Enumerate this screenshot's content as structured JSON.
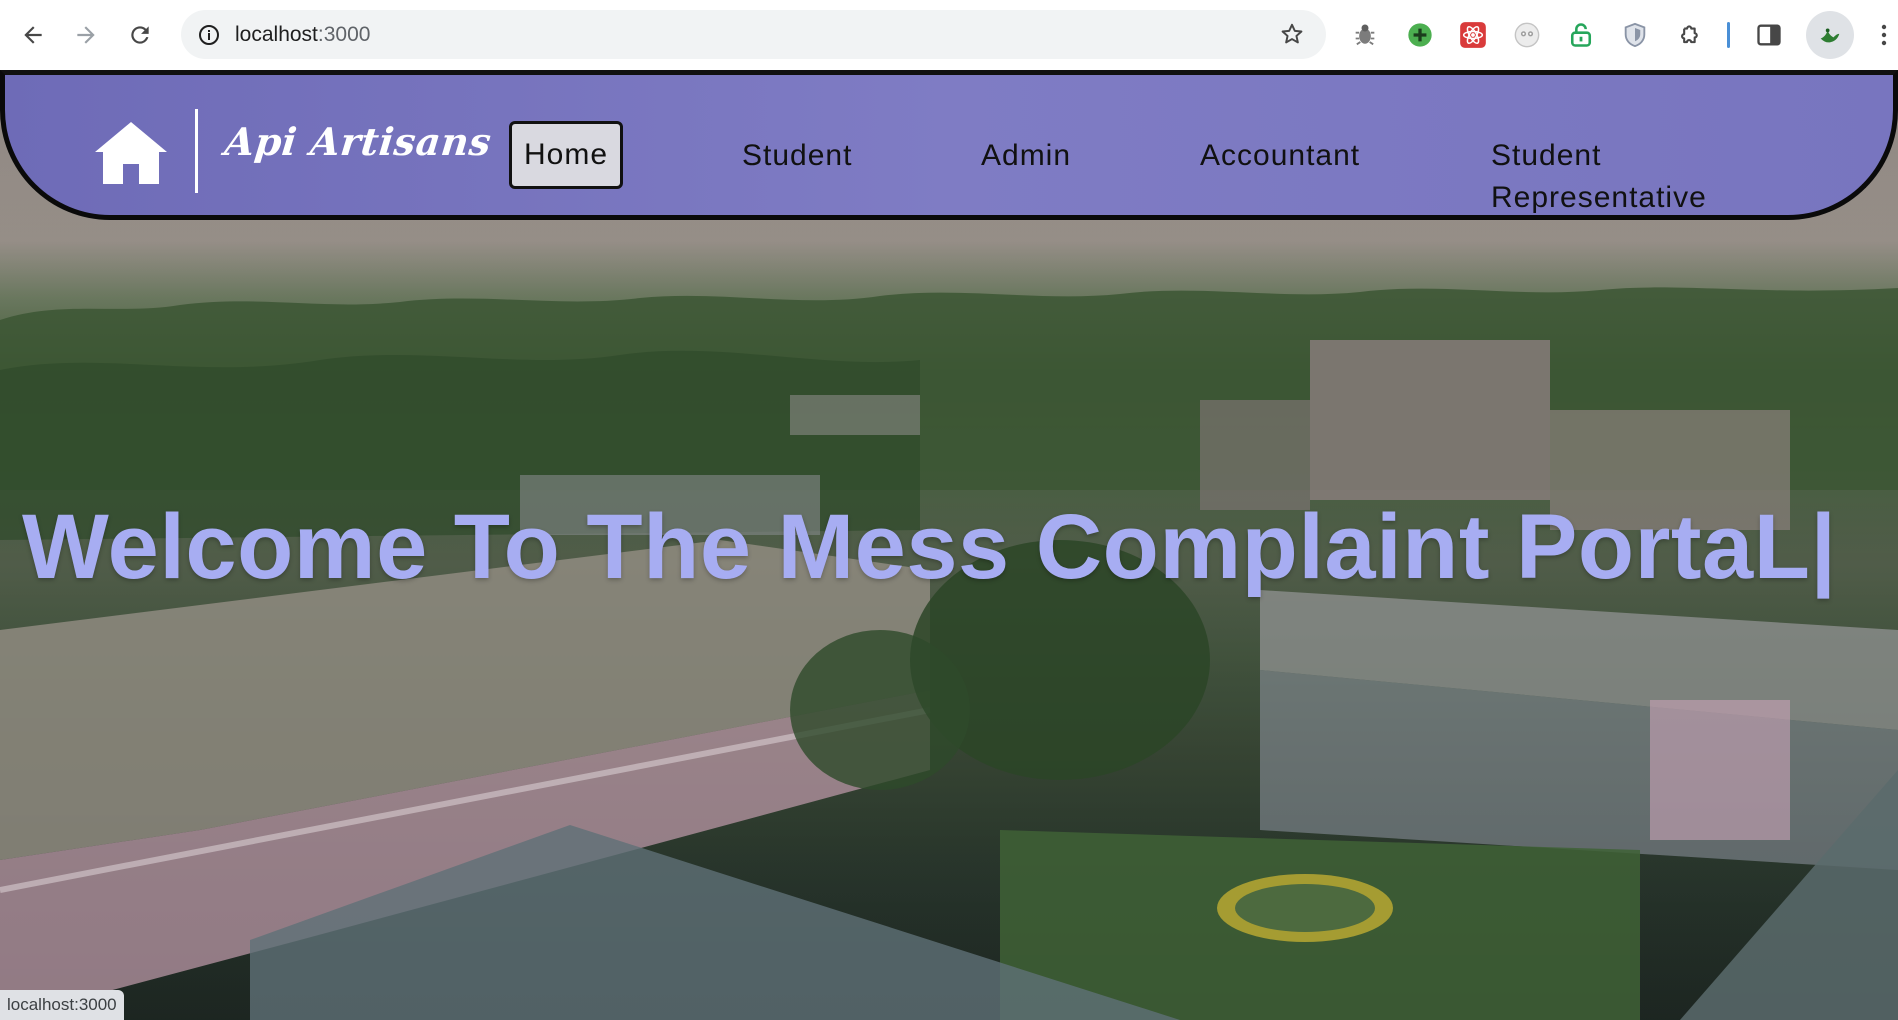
{
  "browser": {
    "url_host": "localhost",
    "url_port": ":3000",
    "status_text": "localhost:3000",
    "extensions": [
      {
        "name": "bug-extension-icon",
        "color": "#7c7c7c"
      },
      {
        "name": "plus-extension-icon",
        "color": "#4caf50"
      },
      {
        "name": "atom-extension-icon",
        "color": "#d93b3b"
      },
      {
        "name": "face-extension-icon",
        "color": "#9e9e9e"
      },
      {
        "name": "lock-extension-icon",
        "color": "#26a65b"
      },
      {
        "name": "shield-extension-icon",
        "color": "#8a94a6"
      },
      {
        "name": "puzzle-extension-icon",
        "color": "#474747"
      }
    ]
  },
  "navbar": {
    "brand": "Api Artisans",
    "links": {
      "home": "Home",
      "student": "Student",
      "admin": "Admin",
      "accountant": "Accountant",
      "student_representative": "Student Representative"
    },
    "colors": {
      "background": "#7f7cc4",
      "active_bg": "#d9d9e0"
    }
  },
  "hero": {
    "title": "Welcome To The Mess Complaint PortaL|",
    "title_color": "#a7adf2"
  }
}
